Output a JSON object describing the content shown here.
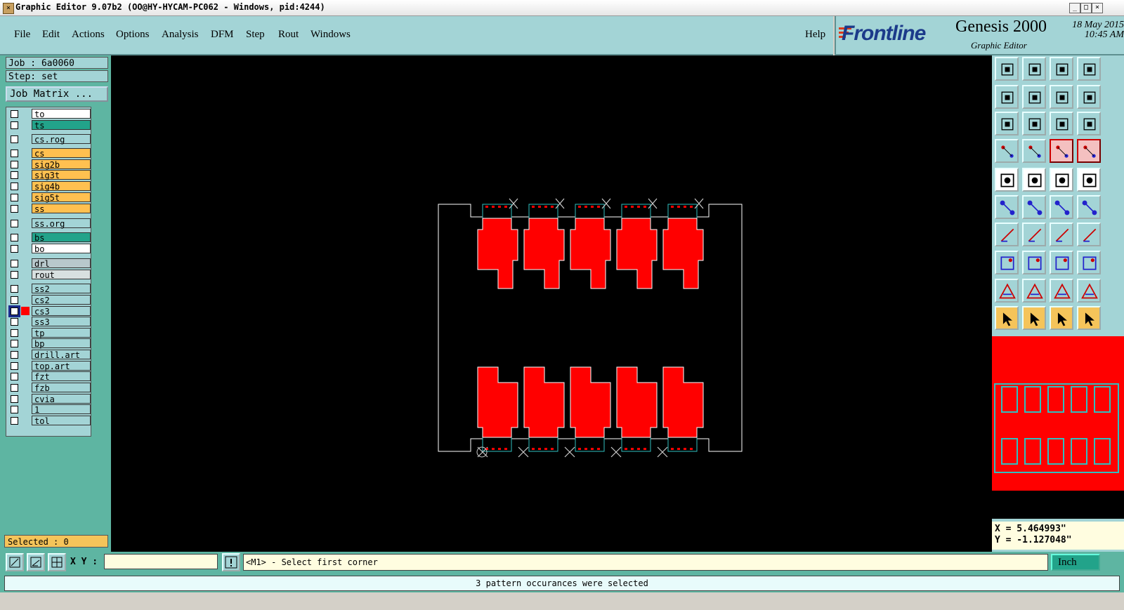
{
  "window": {
    "title": "Graphic Editor 9.07b2 (OO@HY-HYCAM-PC062 - Windows, pid:4244)",
    "controls": [
      "_",
      "□",
      "×"
    ]
  },
  "menu": {
    "items": [
      "File",
      "Edit",
      "Actions",
      "Options",
      "Analysis",
      "DFM",
      "Step",
      "Rout",
      "Windows"
    ],
    "help": "Help"
  },
  "branding": {
    "company": "Frontline",
    "product": "Genesis 2000",
    "subtitle": "Graphic Editor",
    "date": "18 May 2015",
    "time": "10:45 AM"
  },
  "job": {
    "job_line": "Job : 6a0060",
    "step_line": "Step: set",
    "matrix_button": "Job Matrix ..."
  },
  "layers": [
    {
      "name": "to",
      "color": "#ffffff"
    },
    {
      "name": "ts",
      "color": "#22a38a"
    },
    {
      "name": "cs.rog",
      "color": "#a3d4d6"
    },
    {
      "name": "cs",
      "color": "#ffc050"
    },
    {
      "name": "sig2b",
      "color": "#ffc050"
    },
    {
      "name": "sig3t",
      "color": "#ffc050"
    },
    {
      "name": "sig4b",
      "color": "#ffc050"
    },
    {
      "name": "sig5t",
      "color": "#ffc050"
    },
    {
      "name": "ss",
      "color": "#ffc050"
    },
    {
      "name": "ss.org",
      "color": "#a3d4d6"
    },
    {
      "name": "bs",
      "color": "#22a38a"
    },
    {
      "name": "bo",
      "color": "#ffffff"
    },
    {
      "name": "drl",
      "color": "#b8c8cc"
    },
    {
      "name": "rout",
      "color": "#d8e0e0"
    },
    {
      "name": "ss2",
      "color": "#a3d4d6"
    },
    {
      "name": "cs2",
      "color": "#a3d4d6"
    },
    {
      "name": "cs3",
      "color": "#a3d4d6"
    },
    {
      "name": "ss3",
      "color": "#a3d4d6"
    },
    {
      "name": "tp",
      "color": "#a3d4d6"
    },
    {
      "name": "bp",
      "color": "#a3d4d6"
    },
    {
      "name": "drill.art",
      "color": "#a3d4d6"
    },
    {
      "name": "top.art",
      "color": "#a3d4d6"
    },
    {
      "name": "fzt",
      "color": "#a3d4d6"
    },
    {
      "name": "fzb",
      "color": "#a3d4d6"
    },
    {
      "name": "cvia",
      "color": "#a3d4d6"
    },
    {
      "name": "1",
      "color": "#a3d4d6"
    },
    {
      "name": "tol",
      "color": "#a3d4d6"
    }
  ],
  "selected": "Selected : 0",
  "coordinates": {
    "x": "X = 5.464993\"",
    "y": "Y = -1.127048\""
  },
  "command": {
    "xy_label": "X Y :",
    "xy_value": "",
    "prompt": "<M1> - Select first corner",
    "units": "Inch"
  },
  "status": "3 pattern occurances were selected",
  "colors": {
    "feature": "#ff0000",
    "outline": "#ffffff",
    "panel": "#a3d4d6",
    "background": "#000000"
  }
}
